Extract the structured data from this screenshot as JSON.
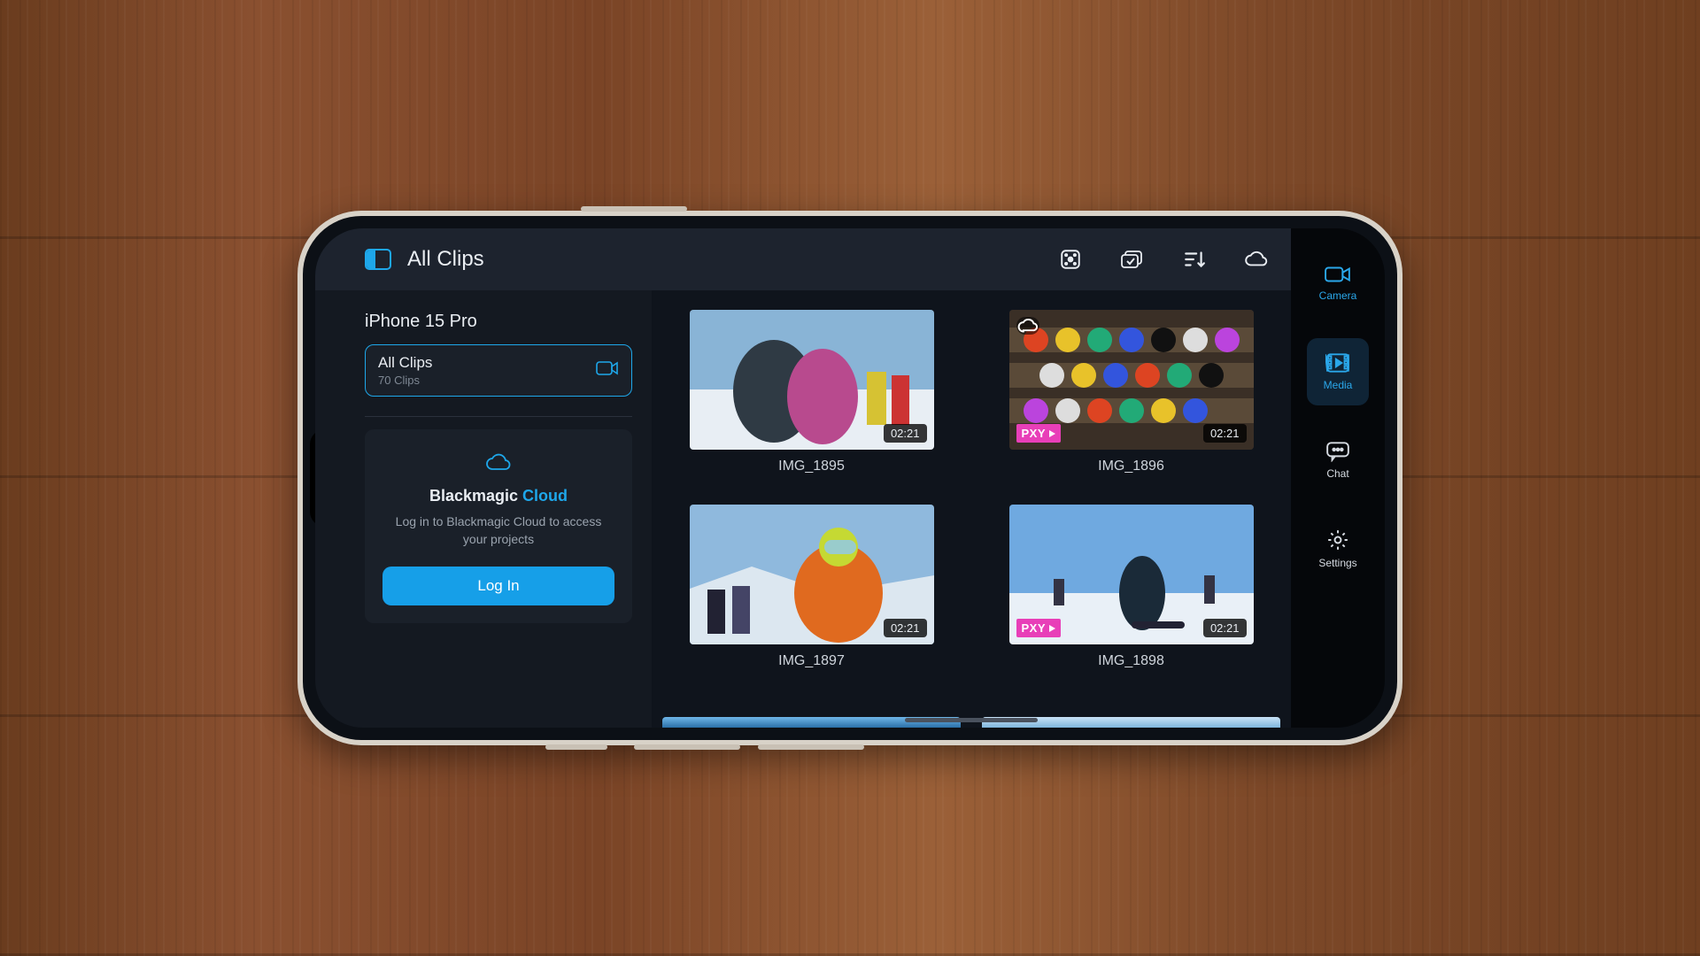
{
  "header": {
    "title": "All Clips",
    "icons": [
      "grid-icon",
      "select-icon",
      "sort-icon",
      "cloud-icon"
    ]
  },
  "sidebar": {
    "device": "iPhone 15 Pro",
    "folder": {
      "name": "All Clips",
      "count": "70 Clips"
    },
    "cloud": {
      "title_a": "Blackmagic ",
      "title_b": "Cloud",
      "subtitle": "Log in to Blackmagic Cloud to access your projects",
      "login": "Log In"
    }
  },
  "clips": [
    {
      "name": "IMG_1895",
      "duration": "02:21",
      "pxy": false,
      "cloud": false
    },
    {
      "name": "IMG_1896",
      "duration": "02:21",
      "pxy": true,
      "cloud": true
    },
    {
      "name": "IMG_1897",
      "duration": "02:21",
      "pxy": false,
      "cloud": false
    },
    {
      "name": "IMG_1898",
      "duration": "02:21",
      "pxy": true,
      "cloud": false
    }
  ],
  "rail": {
    "items": [
      {
        "label": "Camera",
        "active": false
      },
      {
        "label": "Media",
        "active": true
      },
      {
        "label": "Chat",
        "active": false
      },
      {
        "label": "Settings",
        "active": false
      }
    ]
  },
  "badges": {
    "pxy": "PXY"
  },
  "colors": {
    "accent": "#1ea7ea",
    "pxy": "#e83fb8"
  }
}
